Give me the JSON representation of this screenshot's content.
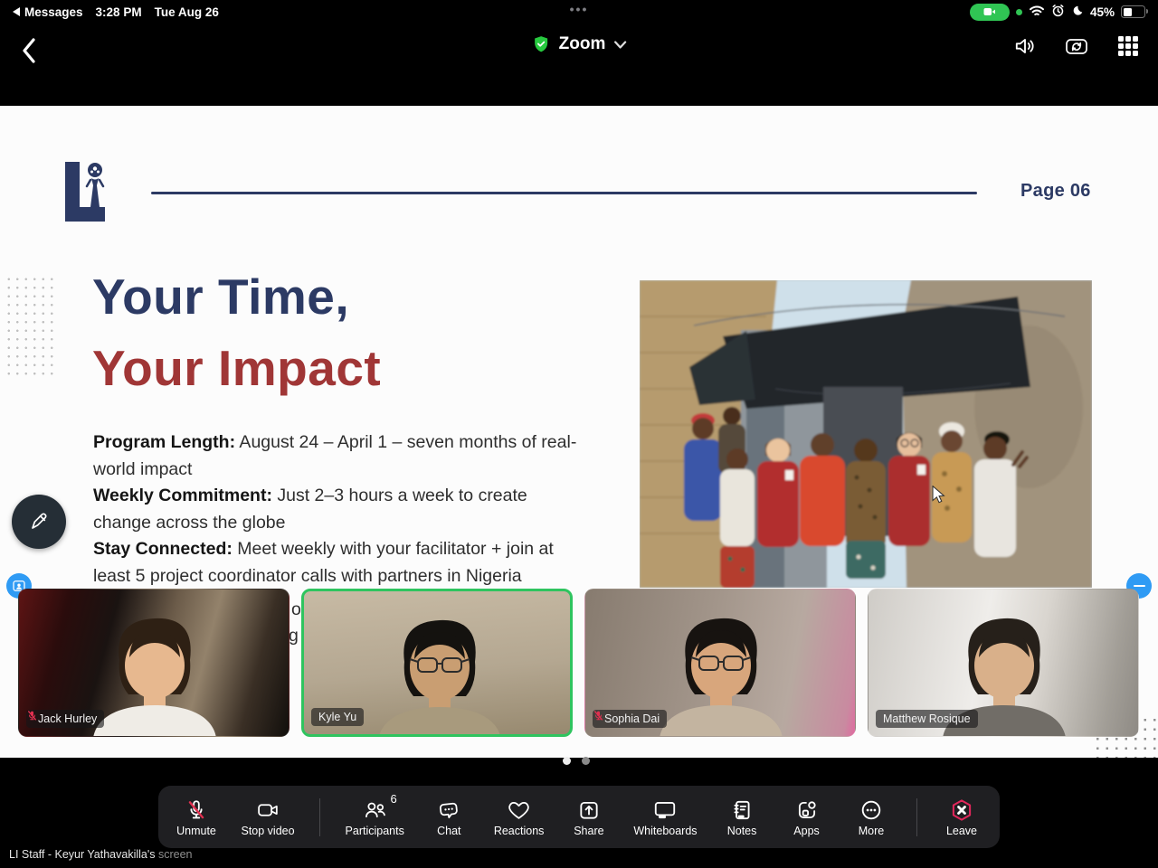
{
  "status_bar": {
    "back_to_app": "Messages",
    "time": "3:28 PM",
    "date": "Tue Aug 26",
    "center_dots": "•••",
    "battery_percent": "45%",
    "right_icons": [
      "camera-in-use-pill",
      "green-dot",
      "wifi-icon",
      "alarm-icon",
      "moon-icon",
      "battery-icon"
    ]
  },
  "nav_bar": {
    "title": "Zoom",
    "left_icons": [
      "back-chevron-icon"
    ],
    "title_icons": [
      "shield-check-icon",
      "chevron-down-icon"
    ],
    "right_icons": [
      "speaker-icon",
      "camera-flip-icon",
      "apps-grid-icon"
    ]
  },
  "slide": {
    "page_label": "Page 06",
    "title_line1": "Your Time,",
    "title_line2": "Your Impact",
    "body_lines": [
      {
        "bold": "Program Length:",
        "rest": " August 24 – April 1 – seven months of real-world impact"
      },
      {
        "bold": "Weekly Commitment:",
        "rest": " Just 2–3 hours a week to create change across the globe"
      },
      {
        "bold": "Stay Connected:",
        "rest": " Meet weekly with your facilitator + join at least 5 project coordinator calls with partners in Nigeria"
      }
    ],
    "cutoff_fragments": [
      "o",
      "g"
    ]
  },
  "participants": [
    {
      "name": "Jack Hurley",
      "muted": true,
      "active": false,
      "variant": "jack"
    },
    {
      "name": "Kyle Yu",
      "muted": false,
      "active": true,
      "variant": "kyle"
    },
    {
      "name": "Sophia Dai",
      "muted": true,
      "active": false,
      "variant": "sophia"
    },
    {
      "name": "Matthew Rosique",
      "muted": false,
      "active": false,
      "variant": "matthew"
    }
  ],
  "pagination": {
    "dot_count": 2,
    "active_index": 0
  },
  "toolbar": {
    "items": [
      {
        "label": "Unmute",
        "icon": "mic-muted"
      },
      {
        "label": "Stop video",
        "icon": "video"
      },
      {
        "label": "Participants",
        "icon": "participants",
        "badge": "6",
        "divider_before": true
      },
      {
        "label": "Chat",
        "icon": "chat"
      },
      {
        "label": "Reactions",
        "icon": "heart"
      },
      {
        "label": "Share",
        "icon": "share"
      },
      {
        "label": "Whiteboards",
        "icon": "whiteboard"
      },
      {
        "label": "Notes",
        "icon": "notes"
      },
      {
        "label": "Apps",
        "icon": "apps"
      },
      {
        "label": "More",
        "icon": "more"
      },
      {
        "label": "Leave",
        "icon": "leave",
        "divider_before": true
      }
    ]
  },
  "footer": {
    "label": "LI Staff - Keyur Yathavakilla's ",
    "suffix": "screen"
  },
  "colors": {
    "accent_green": "#30c554",
    "active_speaker_border": "#2fc45f",
    "leave_red": "#e0265a",
    "muted_mic_red": "#e03050",
    "headline_navy": "#2c3a64",
    "headline_red": "#a03636",
    "selfview_blue": "#2f9bf4"
  }
}
